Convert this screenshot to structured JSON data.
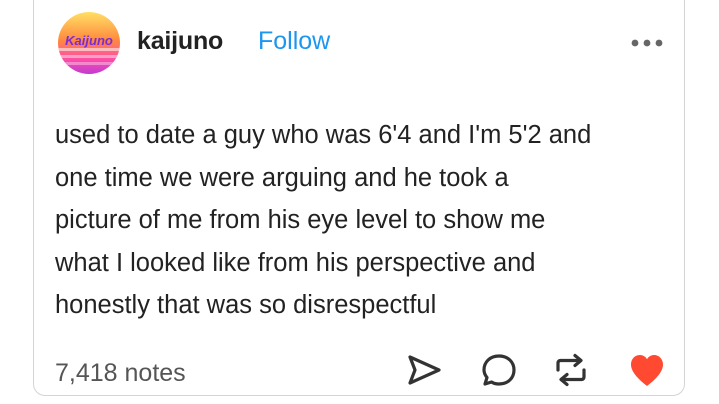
{
  "post": {
    "username": "kaijuno",
    "follow_label": "Follow",
    "avatar_text": "Kaijuno",
    "lines": [
      "used to date a guy who was 6'4 and I'm 5'2 and",
      "one time we were arguing and he took a",
      "picture of me from his eye level to show me",
      "what I looked like from his perspective and",
      "honestly that was so disrespectful"
    ],
    "notes": "7,418 notes"
  },
  "icons": {
    "more": "more-horizontal-icon",
    "share": "share-icon",
    "reply": "reply-icon",
    "reblog": "reblog-icon",
    "like": "heart-icon"
  },
  "colors": {
    "follow": "#1d96f0",
    "heart": "#ff4930",
    "text": "#222222",
    "muted": "#555555"
  }
}
